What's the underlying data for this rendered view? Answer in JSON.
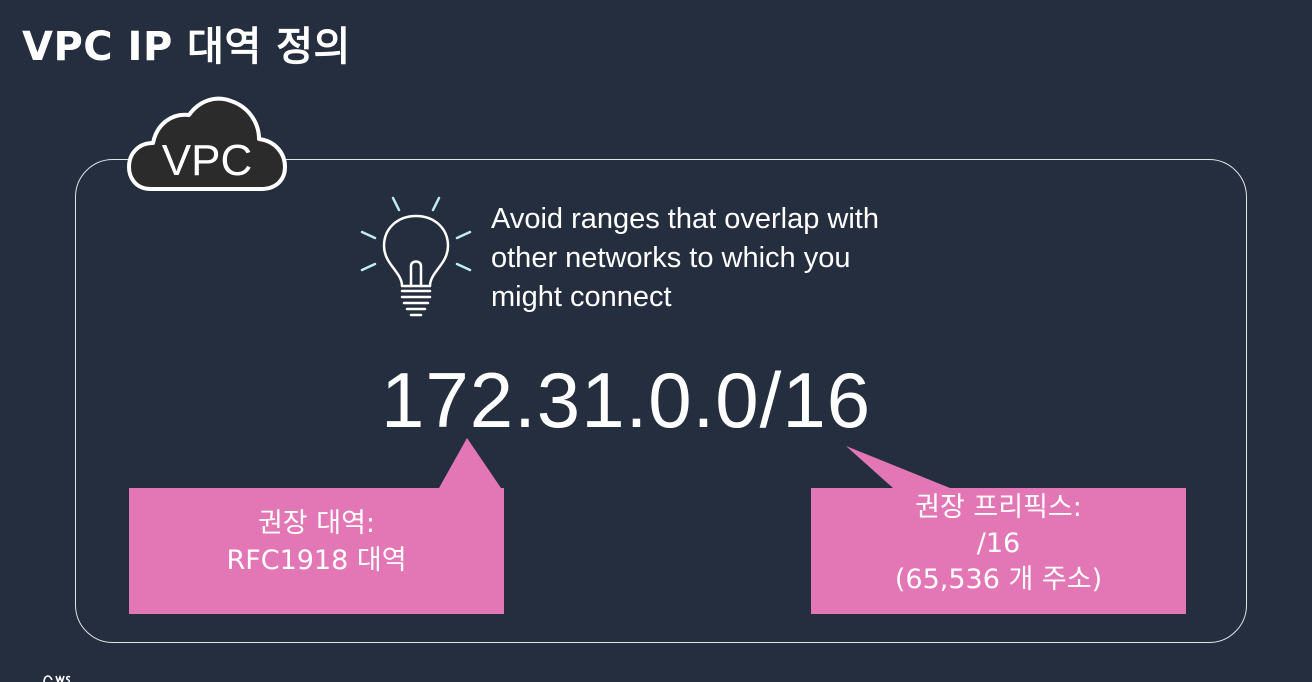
{
  "slide": {
    "title": "VPC IP 대역 정의",
    "colors": {
      "background": "#252e3e",
      "callout": "#e377b5",
      "border": "#dfe3ea",
      "bulb_rays": "#bff0ef"
    }
  },
  "vpc": {
    "badge_label": "VPC",
    "icon": "cloud-icon"
  },
  "tip": {
    "icon": "light-bulb-icon",
    "lines": [
      "Avoid ranges that overlap with",
      "other networks to which you",
      "might connect"
    ]
  },
  "cidr": "172.31.0.0/16",
  "callouts": {
    "range": {
      "lines": [
        "권장 대역:",
        "RFC1918 대역"
      ]
    },
    "prefix": {
      "lines": [
        "권장 프리픽스:",
        "/16",
        "(65,536 개 주소)"
      ]
    }
  }
}
